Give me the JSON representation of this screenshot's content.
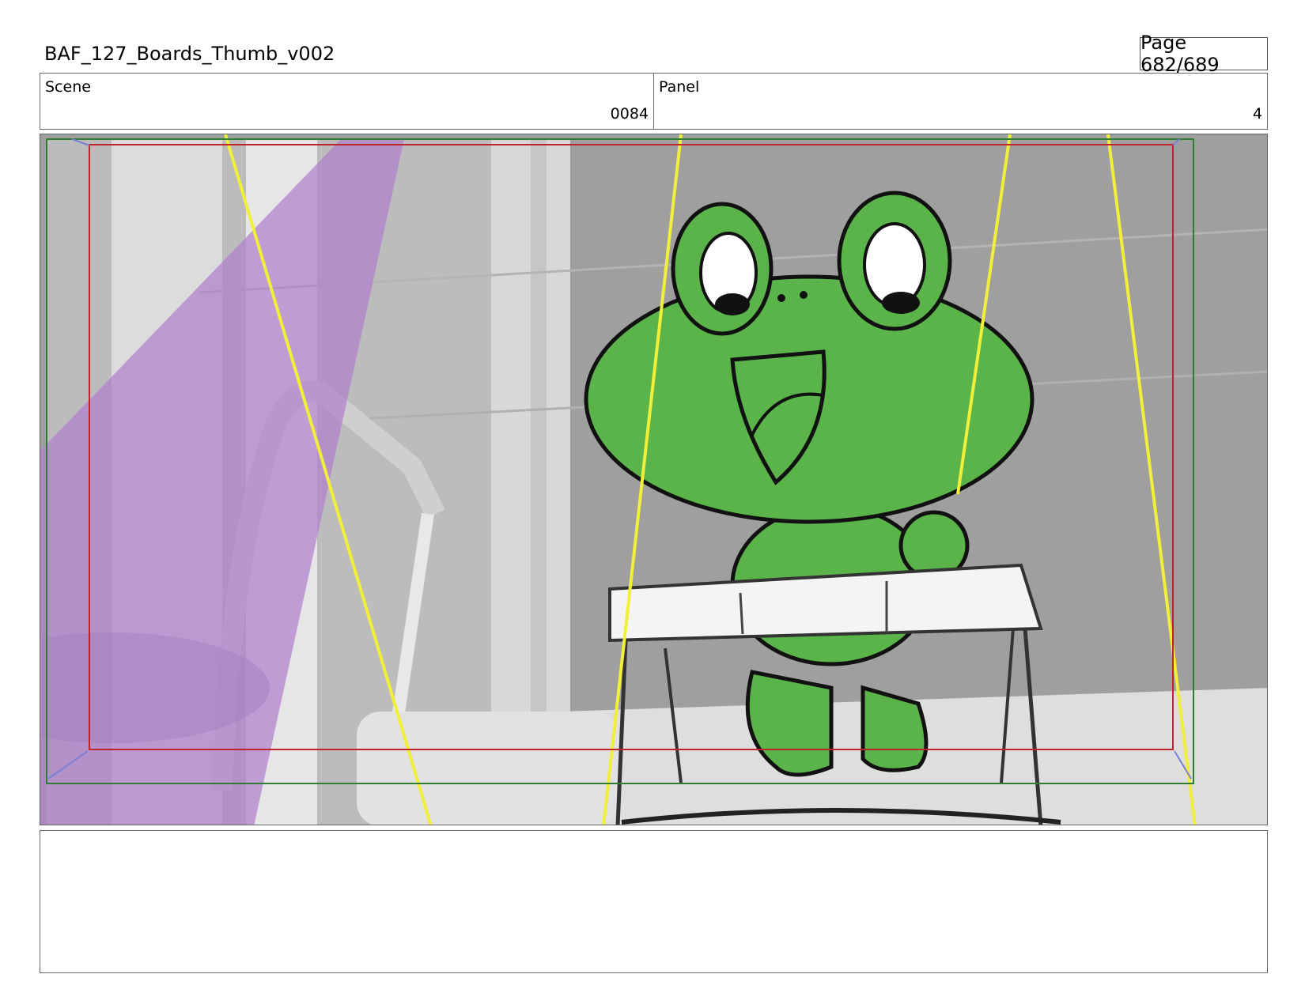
{
  "header": {
    "title": "BAF_127_Boards_Thumb_v002",
    "page": "Page 682/689"
  },
  "info": {
    "scene_label": "Scene",
    "scene_value": "0084",
    "panel_label": "Panel",
    "panel_value": "4"
  },
  "notes": {
    "text": ""
  },
  "colors": {
    "frog_green": "#5ab44a",
    "safe_frame": "#c0242b",
    "camera_frame": "#2e7d32",
    "light_cone": "#b07fcc",
    "guide_lines": "#f2ef3a"
  }
}
